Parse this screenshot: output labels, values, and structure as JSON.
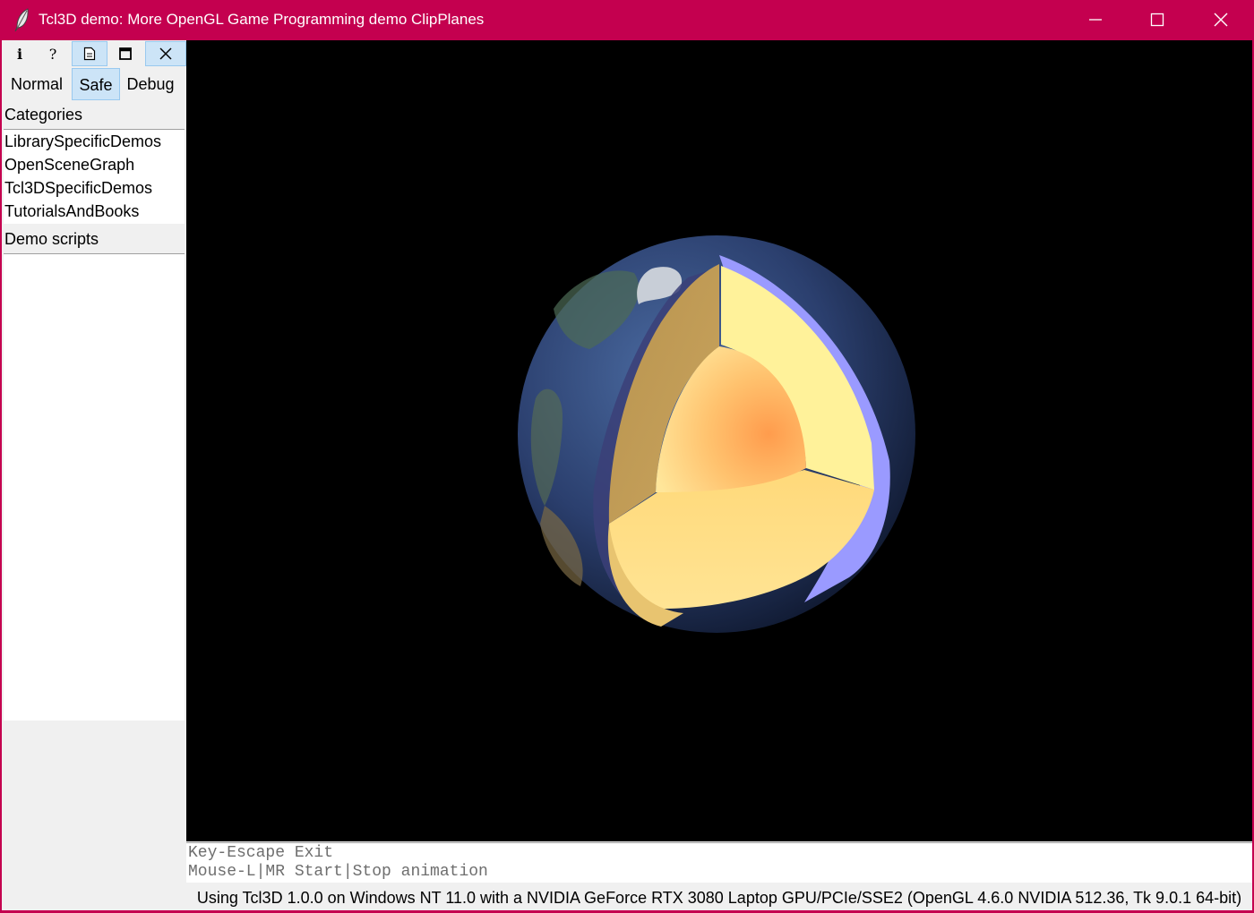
{
  "window": {
    "title": "Tcl3D demo: More OpenGL Game Programming demo ClipPlanes",
    "icon": "feather-icon"
  },
  "toolbar": {
    "buttons": [
      {
        "icon": "info-icon",
        "glyph": "i"
      },
      {
        "icon": "help-icon",
        "glyph": "?"
      },
      {
        "icon": "document-icon",
        "glyph": ""
      },
      {
        "icon": "window-icon",
        "glyph": ""
      },
      {
        "icon": "close-icon",
        "glyph": "×"
      }
    ]
  },
  "modes": {
    "normal": "Normal",
    "safe": "Safe",
    "debug": "Debug",
    "selected": "Safe"
  },
  "categories": {
    "label": "Categories",
    "items": [
      "LibrarySpecificDemos",
      "OpenSceneGraph",
      "Tcl3DSpecificDemos",
      "TutorialsAndBooks"
    ]
  },
  "demo_scripts": {
    "label": "Demo scripts",
    "items": []
  },
  "info": {
    "lines": [
      "Key-Escape Exit",
      "Mouse-L|MR Start|Stop animation"
    ]
  },
  "status": {
    "text": "Using Tcl3D 1.0.0 on Windows NT 11.0 with a NVIDIA GeForce RTX 3080 Laptop GPU/PCIe/SSE2 (OpenGL 4.6.0 NVIDIA 512.36, Tk 9.0.1 64-bit)"
  },
  "colors": {
    "titlebar": "#c4004f",
    "selected_bg": "#cce4f7",
    "canvas_bg": "#000000"
  }
}
